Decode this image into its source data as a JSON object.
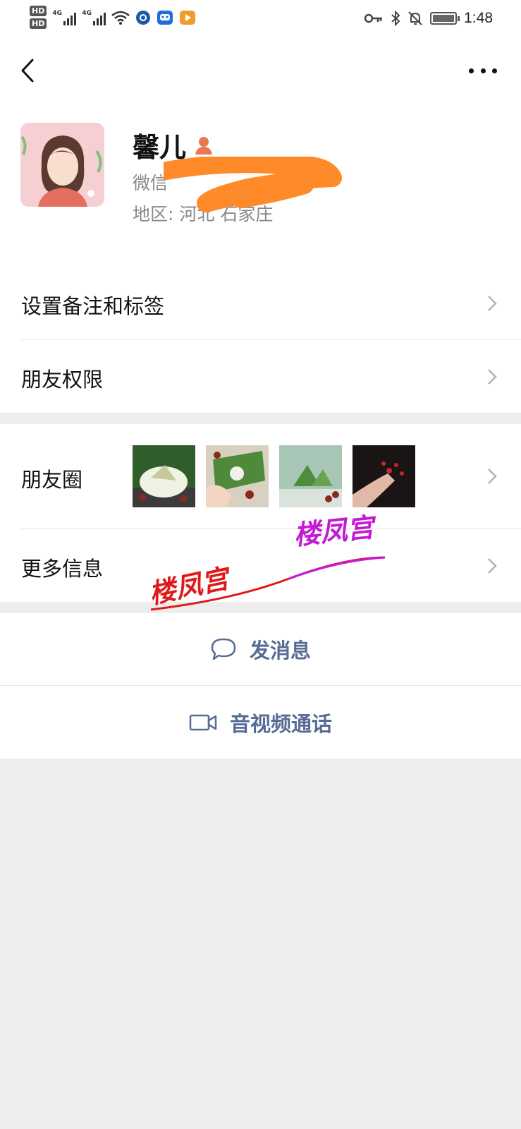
{
  "status_bar": {
    "hd1": "HD",
    "hd2": "HD",
    "net1": "4G",
    "net2": "4G",
    "time": "1:48"
  },
  "header": {
    "back_icon": "chevron-left-icon",
    "more_icon": "more-horizontal-icon"
  },
  "profile": {
    "name": "馨儿",
    "gender_icon": "female-icon",
    "wechat_id_label": "微信",
    "region": "地区: 河北  石家庄"
  },
  "menu": {
    "remark_tags": "设置备注和标签",
    "permissions": "朋友权限",
    "moments": "朋友圈",
    "more_info": "更多信息"
  },
  "actions": {
    "message": "发消息",
    "video_call": "音视频通话"
  },
  "watermarks": [
    "楼凤宫",
    "楼凤宫"
  ],
  "colors": {
    "link_blue": "#576b95",
    "background": "#ededed",
    "gender_icon": "#e8784f",
    "redaction": "#ff8a2a"
  }
}
